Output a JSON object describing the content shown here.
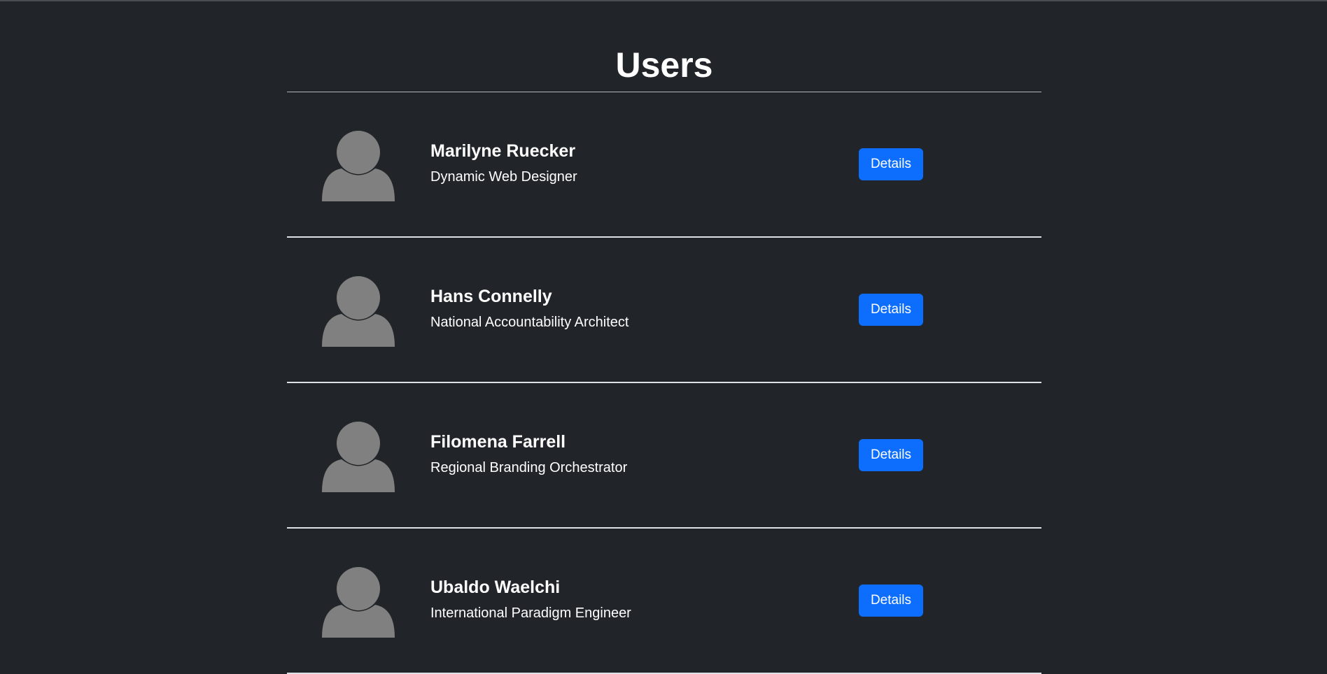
{
  "page": {
    "title": "Users"
  },
  "users": [
    {
      "name": "Marilyne Ruecker",
      "job_title": "Dynamic Web Designer",
      "button_label": "Details",
      "avatar_icon": "user-placeholder-icon"
    },
    {
      "name": "Hans Connelly",
      "job_title": "National Accountability Architect",
      "button_label": "Details",
      "avatar_icon": "user-placeholder-icon"
    },
    {
      "name": "Filomena Farrell",
      "job_title": "Regional Branding Orchestrator",
      "button_label": "Details",
      "avatar_icon": "user-placeholder-icon"
    },
    {
      "name": "Ubaldo Waelchi",
      "job_title": "International Paradigm Engineer",
      "button_label": "Details",
      "avatar_icon": "user-placeholder-icon"
    }
  ],
  "colors": {
    "background": "#212529",
    "accent": "#0d6efd",
    "avatar": "#808080",
    "divider": "#dee2e6"
  }
}
